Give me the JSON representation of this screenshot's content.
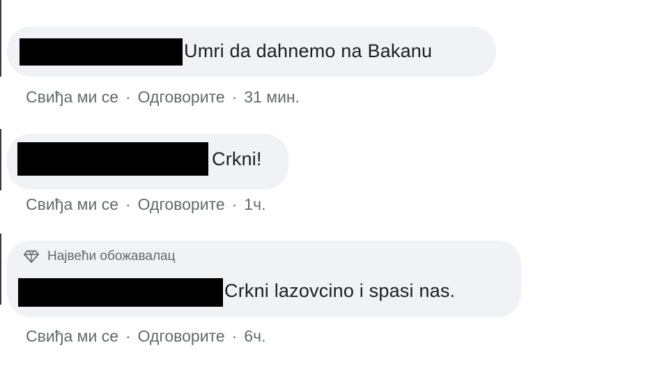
{
  "comments": [
    {
      "text": "Umri da dahnemo na Bakanu",
      "actions": {
        "like": "Свиђа ми се",
        "sep1": "·",
        "reply": "Одговорите",
        "sep2": "·",
        "time": "31 мин."
      }
    },
    {
      "text": "Crkni!",
      "actions": {
        "like": "Свиђа ми се",
        "sep1": "·",
        "reply": "Одговорите",
        "sep2": "·",
        "time": "1ч."
      }
    },
    {
      "badge": {
        "label": "Највећи обожавалац",
        "icon": "diamond-badge-icon"
      },
      "text": "Crkni lazovcino i spasi nas.",
      "actions": {
        "like": "Свиђа ми се",
        "sep1": "·",
        "reply": "Одговорите",
        "sep2": "·",
        "time": "6ч."
      }
    }
  ],
  "colors": {
    "bubble": "#f0f2f5",
    "meta": "#65676b",
    "text": "#1c1e21",
    "redaction": "#000000"
  }
}
